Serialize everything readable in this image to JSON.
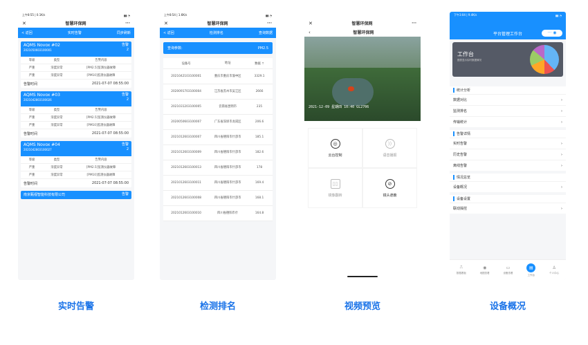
{
  "phone1": {
    "status": "上午8:55 | 0.1K/s",
    "title": "智慧环保网",
    "back": "< 返回",
    "subtitle": "实时告警",
    "action": "同步刷新",
    "col1": "等级",
    "col2": "类型",
    "col3": "告警内容",
    "time_label": "告警时间",
    "cards": [
      {
        "name": "AQMS Novox #02",
        "code": "2021050603100001",
        "alarm": "告警",
        "count": "2",
        "rows": [
          [
            "严重",
            "浓度异常",
            "[PM2.5]监测仪器故障"
          ],
          [
            "严重",
            "浓度异常",
            "[PM10]监测仪器故障"
          ]
        ],
        "time": "2021-07-07 08:55:00"
      },
      {
        "name": "AQMS Novox #03",
        "code": "2021042803100026",
        "alarm": "告警",
        "count": "2",
        "rows": [
          [
            "严重",
            "浓度异常",
            "[PM2.5]监测仪器故障"
          ],
          [
            "严重",
            "浓度异常",
            "[PM10]监测仪器故障"
          ]
        ],
        "time": "2021-07-07 08:55:00"
      },
      {
        "name": "AQMS Novox #04",
        "code": "2021042803100027",
        "alarm": "告警",
        "count": "2",
        "rows": [
          [
            "严重",
            "浓度异常",
            "[PM2.5]监测仪器故障"
          ],
          [
            "严重",
            "浓度异常",
            "[PM10]监测仪器故障"
          ]
        ],
        "time": "2021-07-07 08:55:00"
      }
    ],
    "last": "南京甄视智能科技有限公司",
    "last_alarm": "告警"
  },
  "phone2": {
    "status": "上午8:54 | 1.6K/s",
    "title": "智慧环保网",
    "back": "< 返回",
    "subtitle": "检测排名",
    "action": "查询数据",
    "query_label": "查询参数:",
    "query_value": "PM2.5",
    "h1": "设备号",
    "h2": "地址",
    "h3": "数据 ↑",
    "rows": [
      [
        "2021042103100001",
        "重庆市重庆市渝中区",
        "3329.1"
      ],
      [
        "2020091703100004",
        "江苏省苏州市吴江区",
        "2666"
      ],
      [
        "2021031203100005",
        "云南省昆明市",
        "235"
      ],
      [
        "2020050603100007",
        "广东省深圳市龙岗区",
        "206.6"
      ],
      [
        "2021012603100007",
        "四川省德阳市什邡市",
        "185.1"
      ],
      [
        "2021012603100009",
        "四川省德阳市什邡市",
        "182.6"
      ],
      [
        "2021012603100013",
        "四川省德阳市什邡市",
        "178"
      ],
      [
        "2021012603100011",
        "四川省德阳市什邡市",
        "169.4"
      ],
      [
        "2021012603100008",
        "四川省德阳市什邡市",
        "168.1"
      ],
      [
        "2021012603100010",
        "四川省德阳市什",
        "164.8"
      ]
    ]
  },
  "phone3": {
    "title": "智慧环保网",
    "subtitle": "智慧环保网",
    "overlay": "2021-12-09 星期四 10:40 GL2706",
    "c1": "云台控制",
    "c2": "语音播报",
    "c3": "镜像翻转",
    "c4": "镜头遮蔽"
  },
  "phone4": {
    "status": "下午3:04 | 9.4K/s",
    "title": "平台管理工作台",
    "work_title": "工作台",
    "work_sub": "图表显示实时数据情况",
    "sections": [
      {
        "title": "统计分析",
        "items": [
          "数据对比",
          "监测排名",
          "传输统计"
        ]
      },
      {
        "title": "告警详情",
        "items": [
          "实时告警",
          "历史告警",
          "离线告警"
        ]
      },
      {
        "title": "情况总览",
        "items": [
          "设备概况"
        ]
      },
      {
        "title": "设备设置",
        "items": [
          "联动操控"
        ]
      }
    ],
    "nav": [
      "数据看板",
      "地图查看",
      "设备查看",
      "工作台",
      "个人中心"
    ]
  },
  "labels": [
    "实时告警",
    "检测排名",
    "视频预览",
    "设备概况"
  ]
}
